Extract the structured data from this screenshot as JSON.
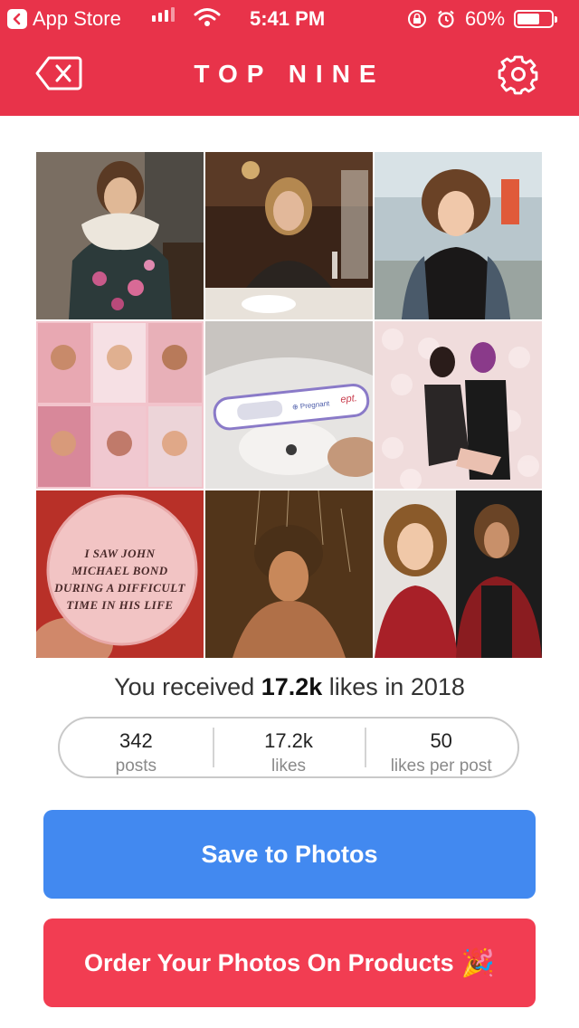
{
  "status_bar": {
    "back_app": "App Store",
    "time": "5:41 PM",
    "battery": "60%"
  },
  "nav": {
    "title": "TOP NINE",
    "left_icon": "backspace-close-icon",
    "right_icon": "gear-icon"
  },
  "grid": {
    "photos": [
      "girl-in-lace-collar-dress-photo",
      "woman-at-restaurant-table-photo",
      "woman-with-tattoos-outdoors-photo",
      "photo-booth-collage-photo",
      "pregnancy-test-photo",
      "couple-flower-wall-photo",
      "pin-button-photo",
      "shower-portrait-photo",
      "selfie-with-wrestler-photo"
    ],
    "pin_button_text": [
      "I SAW JOHN",
      "MICHAEL BOND",
      "DURING A DIFFICULT",
      "TIME IN HIS LIFE"
    ]
  },
  "summary": {
    "prefix": "You received ",
    "likes": "17.2k",
    "suffix": " likes in 2018"
  },
  "stats": [
    {
      "value": "342",
      "label": "posts"
    },
    {
      "value": "17.2k",
      "label": "likes"
    },
    {
      "value": "50",
      "label": "likes per post"
    }
  ],
  "buttons": {
    "save": "Save to Photos",
    "order": "Order Your Photos On Products",
    "order_emoji": "🎉"
  },
  "colors": {
    "header": "#e8334a",
    "save_button": "#4289f0",
    "order_button": "#f23d52"
  }
}
